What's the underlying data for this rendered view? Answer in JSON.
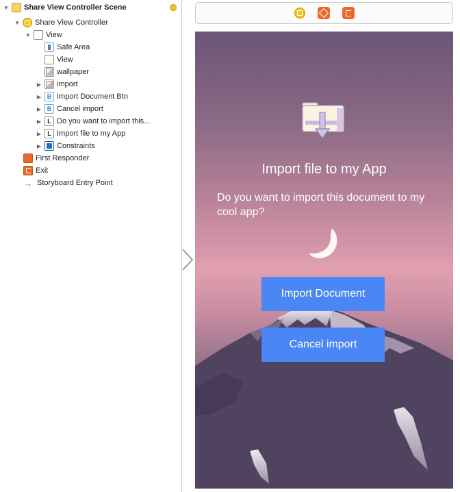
{
  "outline": {
    "rows": [
      {
        "label": "Share View Controller Scene"
      },
      {
        "label": "Share View Controller"
      },
      {
        "label": "View"
      },
      {
        "label": "Safe Area"
      },
      {
        "label": "View"
      },
      {
        "label": "wallpaper"
      },
      {
        "label": "import"
      },
      {
        "label": "Import Document Btn"
      },
      {
        "label": "Cancel import"
      },
      {
        "label": "Do you want to import this..."
      },
      {
        "label": "Import file to my App"
      },
      {
        "label": "Constraints"
      },
      {
        "label": "First Responder"
      },
      {
        "label": "Exit"
      },
      {
        "label": "Storyboard Entry Point"
      }
    ],
    "icon_letters": {
      "button": "B",
      "label": "L"
    }
  },
  "scene": {
    "title": "Import file to my App",
    "message": "Do you want to import this document to my cool app?",
    "import_button": "Import Document",
    "cancel_button": "Cancel import"
  },
  "colors": {
    "button_blue": "#4a87f5",
    "sky_top": "#6c5576",
    "sky_mid": "#e0a0b0",
    "mountain": "#4f4360"
  },
  "icons": {
    "dock": [
      "view-controller-icon",
      "first-responder-icon",
      "exit-icon"
    ]
  }
}
